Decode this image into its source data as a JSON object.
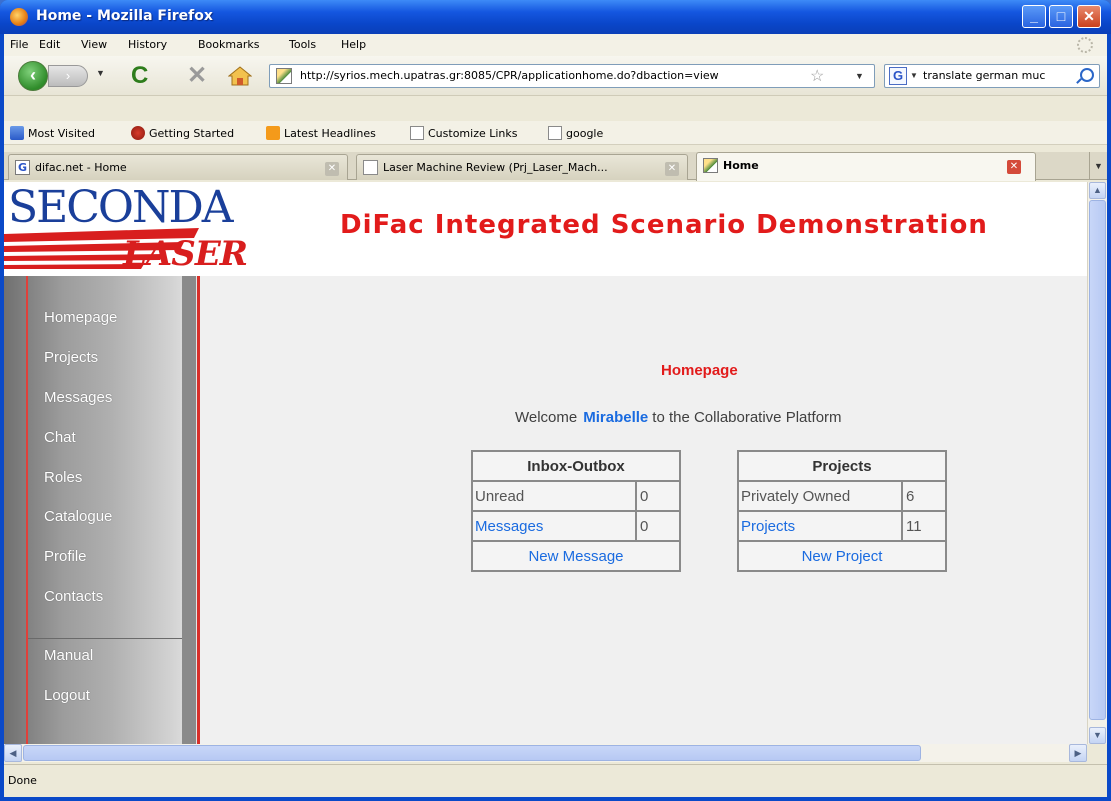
{
  "window": {
    "title": "Home - Mozilla Firefox"
  },
  "menubar": {
    "items": [
      "File",
      "Edit",
      "View",
      "History",
      "Bookmarks",
      "Tools",
      "Help"
    ]
  },
  "navbar": {
    "url": "http://syrios.mech.upatras.gr:8085/CPR/applicationhome.do?dbaction=view",
    "search_value": "translate german muc"
  },
  "bookmarks": [
    "Most Visited",
    "Getting Started",
    "Latest Headlines",
    "Customize Links",
    "google"
  ],
  "tabs": [
    {
      "label": "difac.net - Home",
      "icon": "G"
    },
    {
      "label": "Laser Machine Review (Prj_Laser_Mach...",
      "icon": ""
    },
    {
      "label": "Home",
      "icon": ""
    }
  ],
  "page": {
    "logo_top": "SECONDA",
    "logo_bottom": "LASER",
    "title": "DiFac Integrated Scenario Demonstration",
    "section_title": "Homepage",
    "welcome_prefix": "Welcome",
    "username": "Mirabelle",
    "welcome_suffix": "to the Collaborative Platform",
    "nav": {
      "main": [
        "Homepage",
        "Projects",
        "Messages",
        "Chat",
        "Roles",
        "Catalogue",
        "Profile",
        "Contacts"
      ],
      "secondary": [
        "Manual",
        "Logout"
      ]
    },
    "inbox": {
      "header": "Inbox-Outbox",
      "rows": [
        {
          "label": "Unread",
          "value": "0"
        },
        {
          "label": "Messages",
          "value": "0"
        }
      ],
      "action": "New Message"
    },
    "projects": {
      "header": "Projects",
      "rows": [
        {
          "label": "Privately Owned",
          "value": "6"
        },
        {
          "label": "Projects",
          "value": "11"
        }
      ],
      "action": "New Project"
    }
  },
  "status": {
    "text": "Done"
  },
  "colors": {
    "accent_red": "#e21b1b",
    "link_blue": "#1a6be0",
    "titlebar_blue": "#0a46c9"
  }
}
